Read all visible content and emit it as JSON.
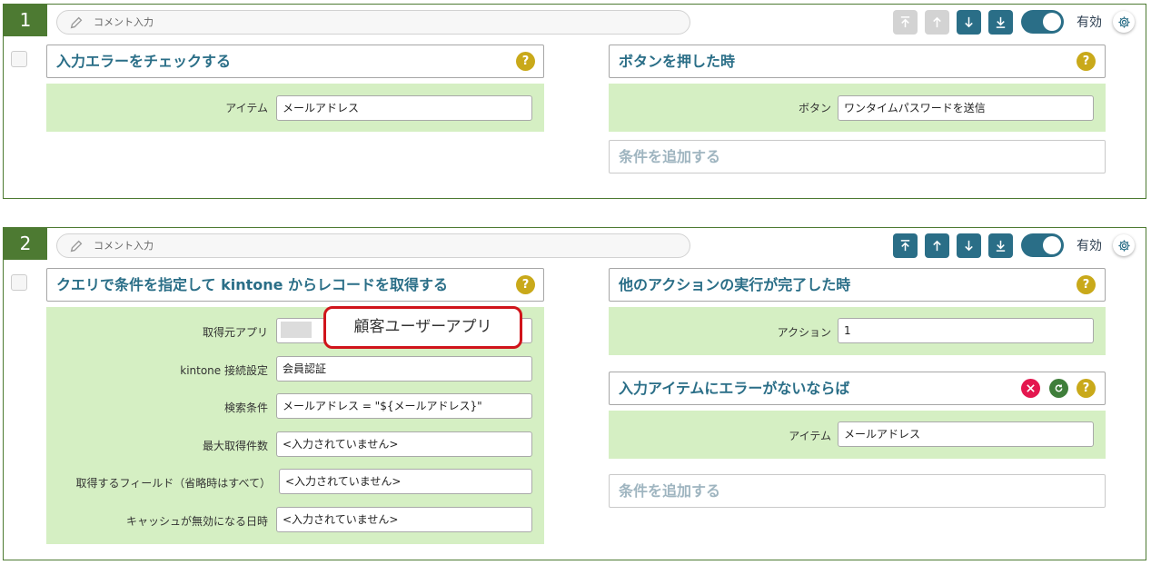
{
  "rules": [
    {
      "number": "1",
      "comment_placeholder": "コメント入力",
      "toggle_label": "有効",
      "action": {
        "title": "入力エラーをチェックする",
        "fields": [
          {
            "label": "アイテム",
            "value": "メールアドレス"
          }
        ]
      },
      "conditions": [
        {
          "title": "ボタンを押した時",
          "fields": [
            {
              "label": "ボタン",
              "value": "ワンタイムパスワードを送信"
            }
          ]
        }
      ],
      "add_condition_label": "条件を追加する"
    },
    {
      "number": "2",
      "comment_placeholder": "コメント入力",
      "toggle_label": "有効",
      "action": {
        "title": "クエリで条件を指定して kintone からレコードを取得する",
        "fields": [
          {
            "label": "取得元アプリ",
            "value": "顧客ユーザーアプリ"
          },
          {
            "label": "kintone 接続設定",
            "value": "会員認証"
          },
          {
            "label": "検索条件",
            "value": "メールアドレス = \"${メールアドレス}\""
          },
          {
            "label": "最大取得件数",
            "value": "<入力されていません>"
          },
          {
            "label": "取得するフィールド（省略時はすべて）",
            "value": "<入力されていません>"
          },
          {
            "label": "キャッシュが無効になる日時",
            "value": "<入力されていません>"
          }
        ]
      },
      "conditions": [
        {
          "title": "他のアクションの実行が完了した時",
          "fields": [
            {
              "label": "アクション",
              "value": "1"
            }
          ]
        },
        {
          "title": "入力アイテムにエラーがないならば",
          "fields": [
            {
              "label": "アイテム",
              "value": "メールアドレス"
            }
          ]
        }
      ],
      "add_condition_label": "条件を追加する"
    }
  ],
  "help_glyph": "?",
  "icons": {
    "comment": "pencil-icon",
    "move_top": "arrow-to-top-icon",
    "move_up": "arrow-up-icon",
    "move_down": "arrow-down-icon",
    "move_bottom": "arrow-to-bottom-icon",
    "settings": "gear-icon",
    "help": "question-icon",
    "delete": "close-icon",
    "invert": "refresh-icon"
  },
  "colors": {
    "rule_border": "#4d7a32",
    "accent": "#2a6e87",
    "disabled": "#d3d3d3",
    "block_body": "#d5efc3",
    "help": "#c9a91a",
    "delete": "#e4174f",
    "invert": "#3f7e3a",
    "callout_border": "#d0141b"
  }
}
